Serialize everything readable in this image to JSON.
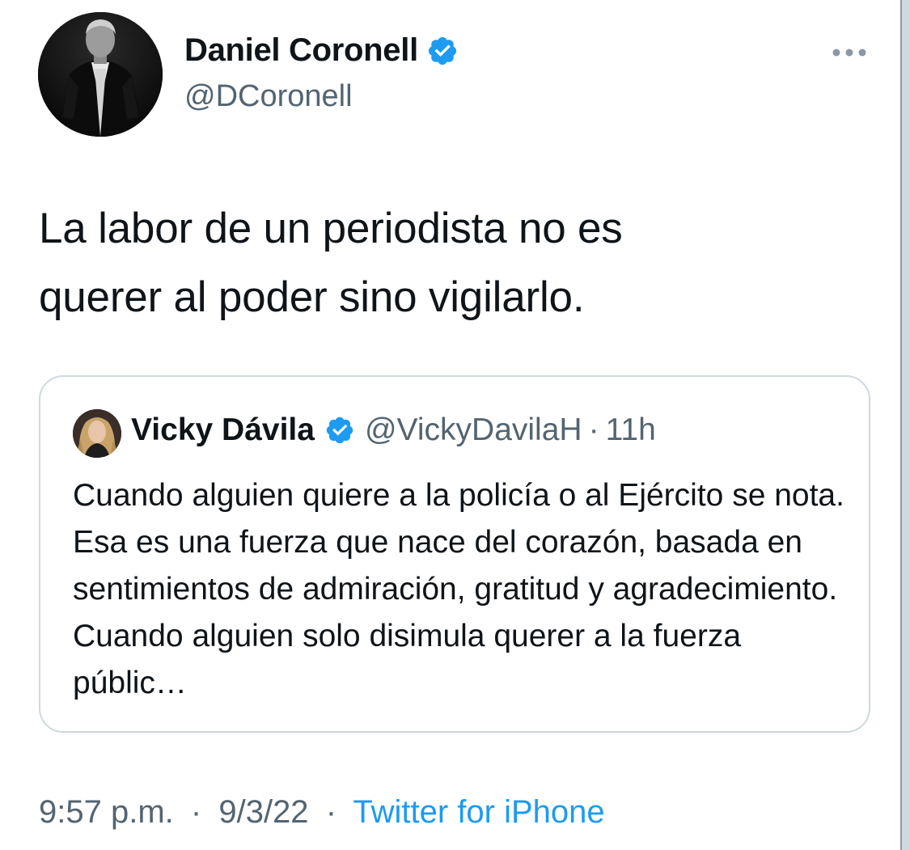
{
  "author": {
    "display_name": "Daniel Coronell",
    "handle": "@DCoronell",
    "verified_icon": "verified-badge-icon",
    "avatar": "avatar"
  },
  "more_icon": "more-horizontal-icon",
  "tweet": {
    "text": "La labor de un periodista no es\nquerer al poder sino vigilarlo."
  },
  "quoted": {
    "display_name": "Vicky Dávila",
    "handle": "@VickyDavilaH",
    "separator": "·",
    "time": "11h",
    "text": "Cuando alguien quiere a la policía o al Ejército se nota. Esa es una fuerza que nace del corazón, basada en sentimientos de admiración, gratitud y agradecimiento. Cuando alguien solo disimula querer a la fuerza públic…"
  },
  "meta": {
    "time": "9:57 p.m.",
    "separator": "·",
    "date": "9/3/22",
    "source": "Twitter for iPhone"
  },
  "colors": {
    "text": "#0f1419",
    "secondary": "#536471",
    "accent": "#1d9bf0",
    "border": "#cfd9de"
  }
}
